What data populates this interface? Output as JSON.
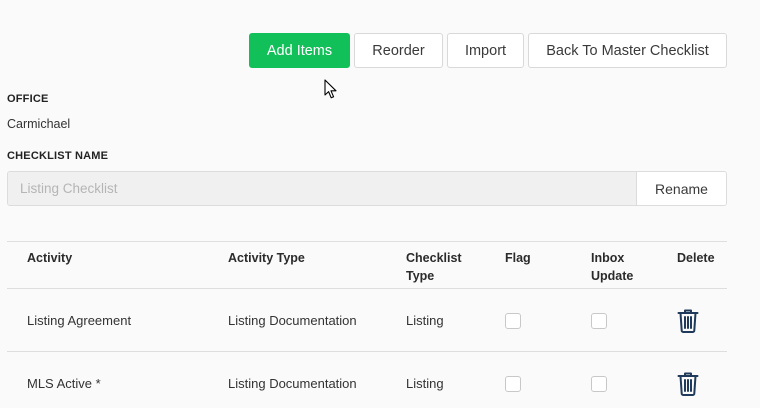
{
  "toolbar": {
    "add_items": "Add Items",
    "reorder": "Reorder",
    "import": "Import",
    "back": "Back To Master Checklist"
  },
  "office": {
    "label": "OFFICE",
    "value": "Carmichael"
  },
  "checklist_name": {
    "label": "CHECKLIST NAME",
    "placeholder": "Listing Checklist",
    "rename": "Rename"
  },
  "table": {
    "headers": {
      "activity": "Activity",
      "activity_type": "Activity Type",
      "checklist_type_1": "Checklist",
      "checklist_type_2": "Type",
      "flag": "Flag",
      "inbox_update_1": "Inbox",
      "inbox_update_2": "Update",
      "delete": "Delete"
    },
    "rows": [
      {
        "activity": "Listing Agreement",
        "activity_type": "Listing Documentation",
        "checklist_type": "Listing",
        "flag": false,
        "inbox_update": false
      },
      {
        "activity": "MLS Active *",
        "activity_type": "Listing Documentation",
        "checklist_type": "Listing",
        "flag": false,
        "inbox_update": false
      }
    ]
  },
  "colors": {
    "primary": "#12c05a",
    "icon": "#1f3a5a"
  },
  "icons": {
    "delete": "trash-icon",
    "pointer": "mouse-cursor-icon"
  }
}
